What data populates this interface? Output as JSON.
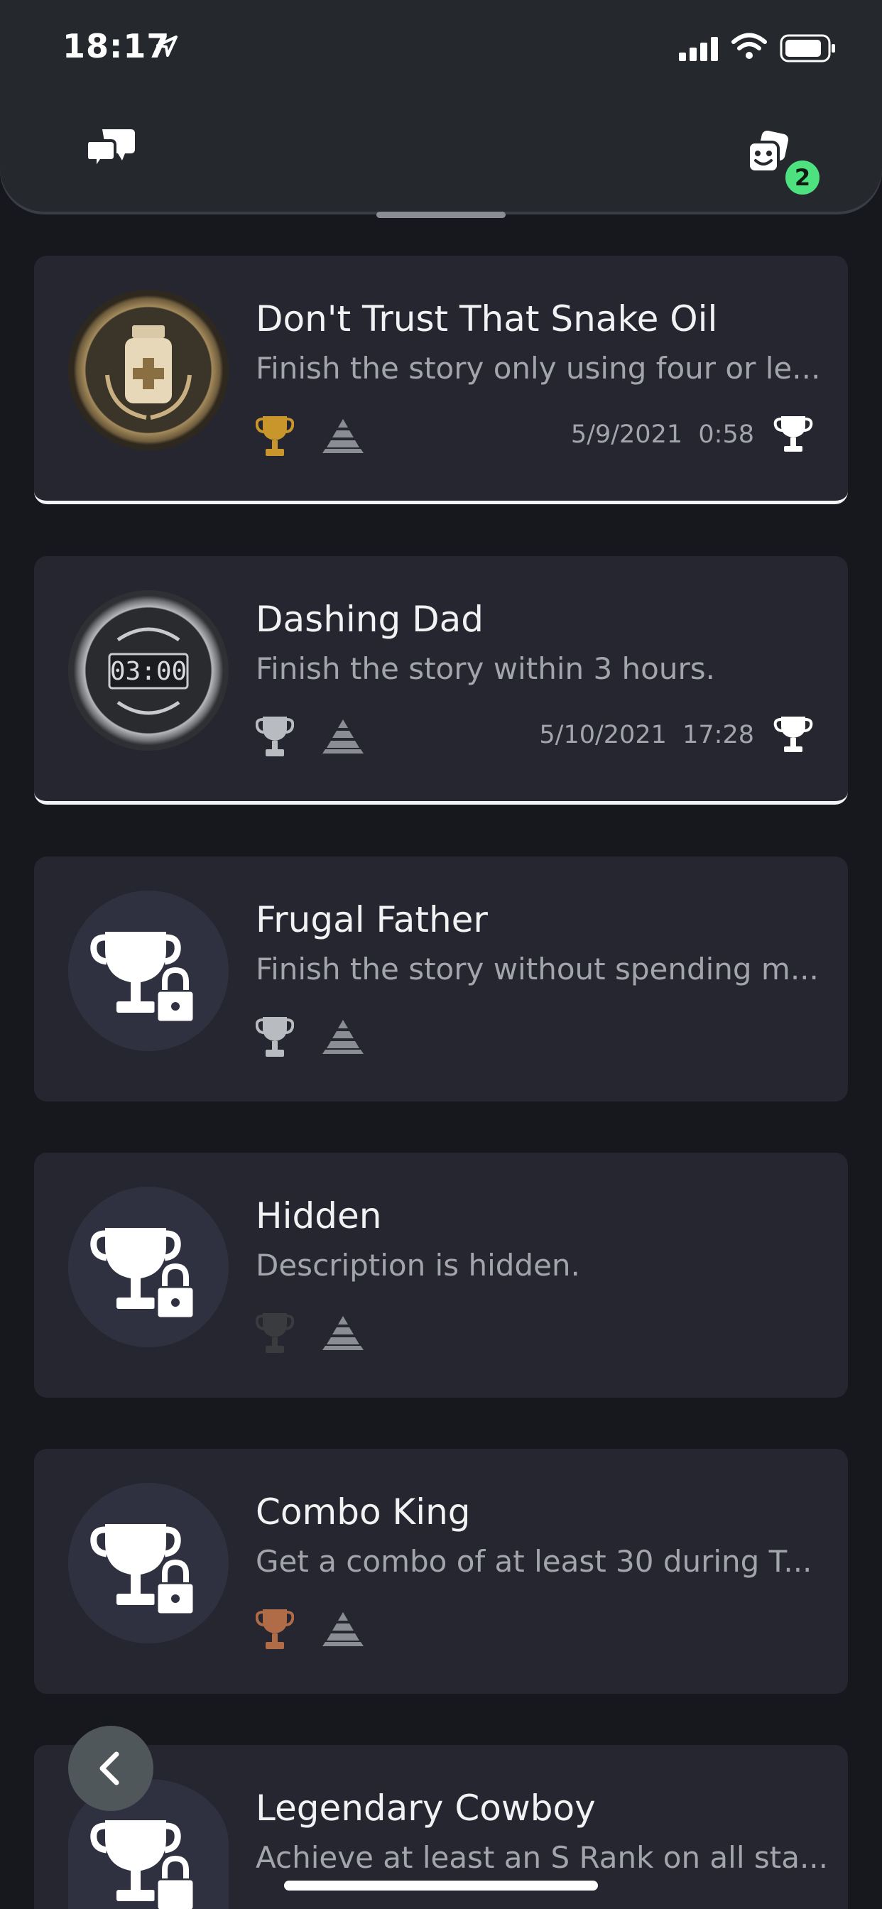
{
  "status_bar": {
    "time": "18:17"
  },
  "header": {
    "notification_count": "2"
  },
  "trophies": [
    {
      "title": "Don't Trust That Snake Oil",
      "description": "Finish the story only using four or le...",
      "grade": "gold",
      "rarity": "common",
      "earned_date": "5/9/2021",
      "earned_time": "0:58",
      "unlocked": true
    },
    {
      "title": "Dashing Dad",
      "description": "Finish the story within 3 hours.",
      "grade": "silver",
      "rarity": "common",
      "earned_date": "5/10/2021",
      "earned_time": "17:28",
      "unlocked": true
    },
    {
      "title": "Frugal Father",
      "description": "Finish the story without spending m...",
      "grade": "silver",
      "rarity": "common",
      "unlocked": false
    },
    {
      "title": "Hidden",
      "description": "Description is hidden.",
      "grade": "hidden",
      "rarity": "uncommon",
      "unlocked": false
    },
    {
      "title": "Combo King",
      "description": "Get a combo of at least 30 during T...",
      "grade": "bronze",
      "rarity": "common",
      "unlocked": false
    },
    {
      "title": "Legendary Cowboy",
      "description": "Achieve at least an S Rank on all sta...",
      "grade": "unknown",
      "rarity": "common",
      "unlocked": false
    }
  ],
  "icons": {
    "chat": "chat-bubbles-icon",
    "game": "game-dice-icon",
    "back": "chevron-left-icon",
    "earned": "trophy-icon",
    "locked": "locked-trophy-icon"
  },
  "colors": {
    "gold": "#c9962c",
    "silver": "#b8bcc0",
    "bronze": "#b06b47",
    "hidden": "#3a3b3f",
    "badge": "#4ee17f"
  }
}
